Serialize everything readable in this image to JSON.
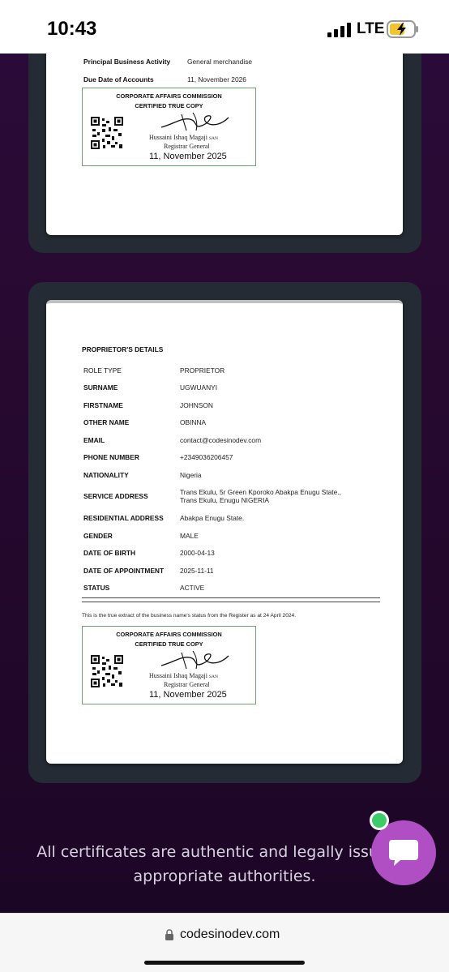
{
  "status_bar": {
    "time": "10:43",
    "network": "LTE",
    "icons": [
      "signal-icon",
      "battery-charging-icon"
    ]
  },
  "doc1": {
    "rows": [
      {
        "label": "Principal Business Activity",
        "value": "General merchandise"
      },
      {
        "label": "Due Date of Accounts",
        "value": "11, November 2026"
      }
    ],
    "cert": {
      "org": "CORPORATE AFFAIRS COMMISSION",
      "title": "CERTIFIED TRUE COPY",
      "name": "Hussaini Ishaq Magaji",
      "suffix": "SAN",
      "role": "Registrar General",
      "date": "11, November 2025"
    }
  },
  "doc2": {
    "section_title": "PROPRIETOR'S DETAILS",
    "rows": [
      {
        "label": "ROLE TYPE",
        "value": "PROPRIETOR"
      },
      {
        "label": "SURNAME",
        "value": "UGWUANYI"
      },
      {
        "label": "FIRSTNAME",
        "value": "JOHNSON"
      },
      {
        "label": "OTHER NAME",
        "value": "OBINNA"
      },
      {
        "label": "EMAIL",
        "value": "contact@codesinodev.com"
      },
      {
        "label": "PHONE NUMBER",
        "value": "+2349036206457"
      },
      {
        "label": "NATIONALITY",
        "value": "Nigeria"
      },
      {
        "label": "SERVICE ADDRESS",
        "value": "Trans Ekulu, 5r Green Kporoko Abakpa Enugu State., Trans Ekulu, Enugu NIGERIA"
      },
      {
        "label": "RESIDENTIAL ADDRESS",
        "value": "Abakpa Enugu State."
      },
      {
        "label": "GENDER",
        "value": "MALE"
      },
      {
        "label": "DATE OF BIRTH",
        "value": "2000-04-13"
      },
      {
        "label": "DATE OF APPOINTMENT",
        "value": "2025-11-11"
      },
      {
        "label": "STATUS",
        "value": "ACTIVE"
      }
    ],
    "extract_note": "This is the true extract of the business name's status from the Register as at 24 April 2024.",
    "cert": {
      "org": "CORPORATE AFFAIRS COMMISSION",
      "title": "CERTIFIED TRUE COPY",
      "name": "Hussaini Ishaq Magaji",
      "suffix": "SAN",
      "role": "Registrar General",
      "date": "11, November 2025"
    }
  },
  "footer": {
    "line1": "All certificates are authentic and legally issued b",
    "line2": "appropriate authorities."
  },
  "chat": {
    "icon": "chat-bubble-icon",
    "status_color": "#3ecb6a"
  },
  "browser": {
    "url": "codesinodev.com",
    "lock_icon": "lock-icon"
  },
  "colors": {
    "background": "#27092f",
    "card_frame": "#252b34",
    "chat_button": "#b04fc4",
    "cert_border": "#6aa86a"
  }
}
